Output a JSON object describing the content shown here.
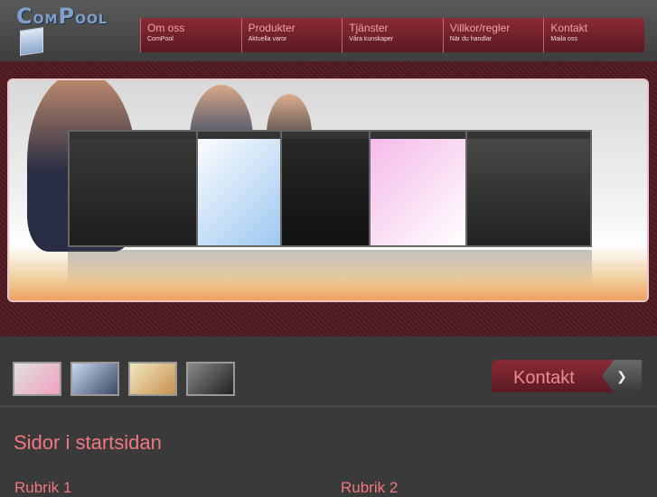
{
  "logo": {
    "text_c": "C",
    "text_om": "OM",
    "text_p": "P",
    "text_ool": "OOL"
  },
  "nav": [
    {
      "label": "Om oss",
      "sub": "ComPool"
    },
    {
      "label": "Produkter",
      "sub": "Aktuella varor"
    },
    {
      "label": "Tjänster",
      "sub": "Våra kunskaper"
    },
    {
      "label": "Villkor/regler",
      "sub": "När du handlar"
    },
    {
      "label": "Kontakt",
      "sub": "Maila oss"
    }
  ],
  "kontakt_button": {
    "label": "Kontakt"
  },
  "section": {
    "title": "Sidor i startsidan"
  },
  "rubriks": [
    "Rubrik 1",
    "Rubrik 2"
  ],
  "colors": {
    "accent": "#f07880",
    "nav_bg": "#7a2430",
    "brand": "#7fa0c8"
  }
}
